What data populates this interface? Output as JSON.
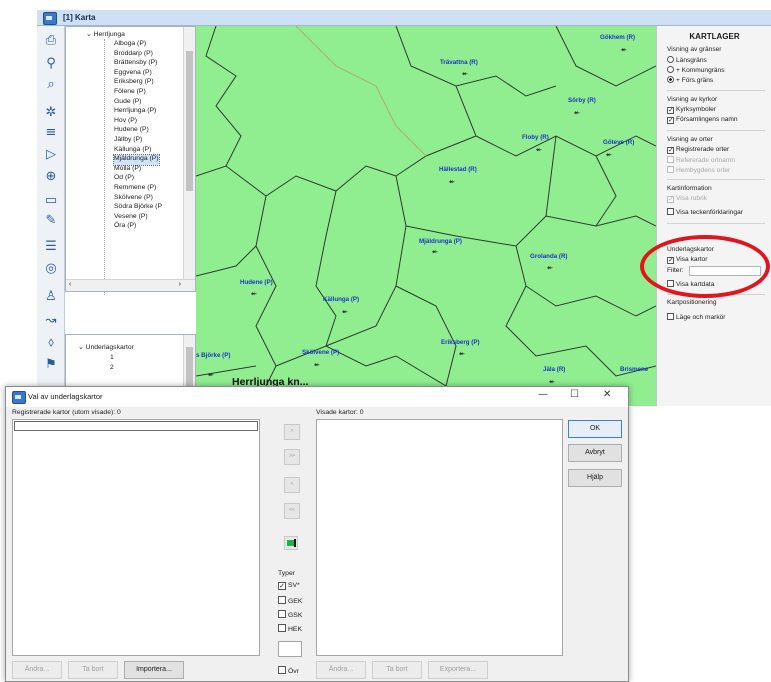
{
  "app": {
    "title": "[1] Karta"
  },
  "toolbar": {
    "icons": [
      "print-icon",
      "zoom-person-icon",
      "search-icon",
      "settings-icon",
      "list-icon",
      "pointer-icon",
      "zoom-icon",
      "ruler-icon",
      "pencil-icon",
      "layers-icon",
      "stack-icon",
      "person-icon",
      "route-icon",
      "shape-icon",
      "pin-icon"
    ]
  },
  "tree": {
    "parent": "Herrljunga",
    "children": [
      "Alboga (P)",
      "Broddarp (P)",
      "Brättensby (P)",
      "Eggvena (P)",
      "Eriksberg (P)",
      "Fölene (P)",
      "Gude (P)",
      "Herrljunga (P)",
      "Hov (P)",
      "Hudene (P)",
      "Jällby (P)",
      "Källunga (P)",
      "Mjäldrunga (P)",
      "Molla (P)",
      "Od (P)",
      "Remmene (P)",
      "Skölvene (P)",
      "Södra Björke (P",
      "Vesene (P)",
      "Öra (P)"
    ],
    "selected_index": 12
  },
  "tree2": {
    "parent": "Underlagskartor",
    "children": [
      "1",
      "2"
    ]
  },
  "map": {
    "places": [
      {
        "name": "Gökhem (R)"
      },
      {
        "name": "Trävattna (R)"
      },
      {
        "name": "Sörby (R)"
      },
      {
        "name": "Floby (R)"
      },
      {
        "name": "Göteve (R)"
      },
      {
        "name": "Hällestad (R)"
      },
      {
        "name": "Mjäldrunga (P)"
      },
      {
        "name": "Grolanda (R)"
      },
      {
        "name": "Hudene (P)"
      },
      {
        "name": "Källunga (P)"
      },
      {
        "name": "Eriksberg (P)"
      },
      {
        "name": "Skölvene (P)"
      },
      {
        "name": "Jäla (R)"
      },
      {
        "name": "Brismene"
      },
      {
        "name": "s Björke (P)"
      }
    ],
    "municipality": "Herrljunga kn...",
    "background_color": "#90ee90",
    "border_color": "#2d3a2d"
  },
  "layers": {
    "title": "KARTLAGER",
    "borders": {
      "label": "Visning av gränser",
      "options": [
        "Länsgräns",
        "+ Kommungräns",
        "+ Förs.gräns"
      ],
      "selected": 2
    },
    "churches": {
      "label": "Visning av kyrkor",
      "options": [
        {
          "label": "Kyrksymboler",
          "checked": true
        },
        {
          "label": "Församlingens namn",
          "checked": true
        }
      ]
    },
    "places": {
      "label": "Visning av orter",
      "options": [
        {
          "label": "Registrerade orter",
          "checked": true,
          "disabled": false
        },
        {
          "label": "Refererade ortnamn",
          "checked": false,
          "disabled": true
        },
        {
          "label": "Hembygdens orter",
          "checked": false,
          "disabled": true
        }
      ]
    },
    "mapinfo": {
      "label": "Kartinformation",
      "options": [
        {
          "label": "Visa rubrik",
          "checked": true,
          "disabled": true
        },
        {
          "label": "Visa teckenförklaringar",
          "checked": false,
          "disabled": false
        }
      ]
    },
    "underlay": {
      "label": "Underlagskartor",
      "visa_kartor": "Visa kartor",
      "visa_kartor_checked": true,
      "filter_label": "Filter:",
      "filter_value": "",
      "visa_kartdata": "Visa kartdata",
      "visa_kartdata_checked": false
    },
    "marker": {
      "label": "Kartpositionering",
      "option": "Läge och markör",
      "checked": false
    }
  },
  "dialog": {
    "title": "Val av underlagskartor",
    "controls": {
      "minimize": "—",
      "maximize": "☐",
      "close": "✕"
    },
    "left_label": "Registrerade kartor (utom visade): 0",
    "right_label": "Visade kartor: 0",
    "move_buttons": [
      ">",
      ">>",
      "<",
      "<<"
    ],
    "types_label": "Typer",
    "types": [
      {
        "label": "SV*",
        "checked": true
      },
      {
        "label": "GEK",
        "checked": false
      },
      {
        "label": "GSK",
        "checked": false
      },
      {
        "label": "HEK",
        "checked": false
      }
    ],
    "ovr_label": "Övr",
    "left_buttons": [
      "Ändra...",
      "Ta bort",
      "Importera..."
    ],
    "right_buttons": [
      "Ändra...",
      "Ta bort",
      "Exportera..."
    ],
    "side_buttons": {
      "ok": "OK",
      "cancel": "Avbryt",
      "help": "Hjälp"
    }
  }
}
